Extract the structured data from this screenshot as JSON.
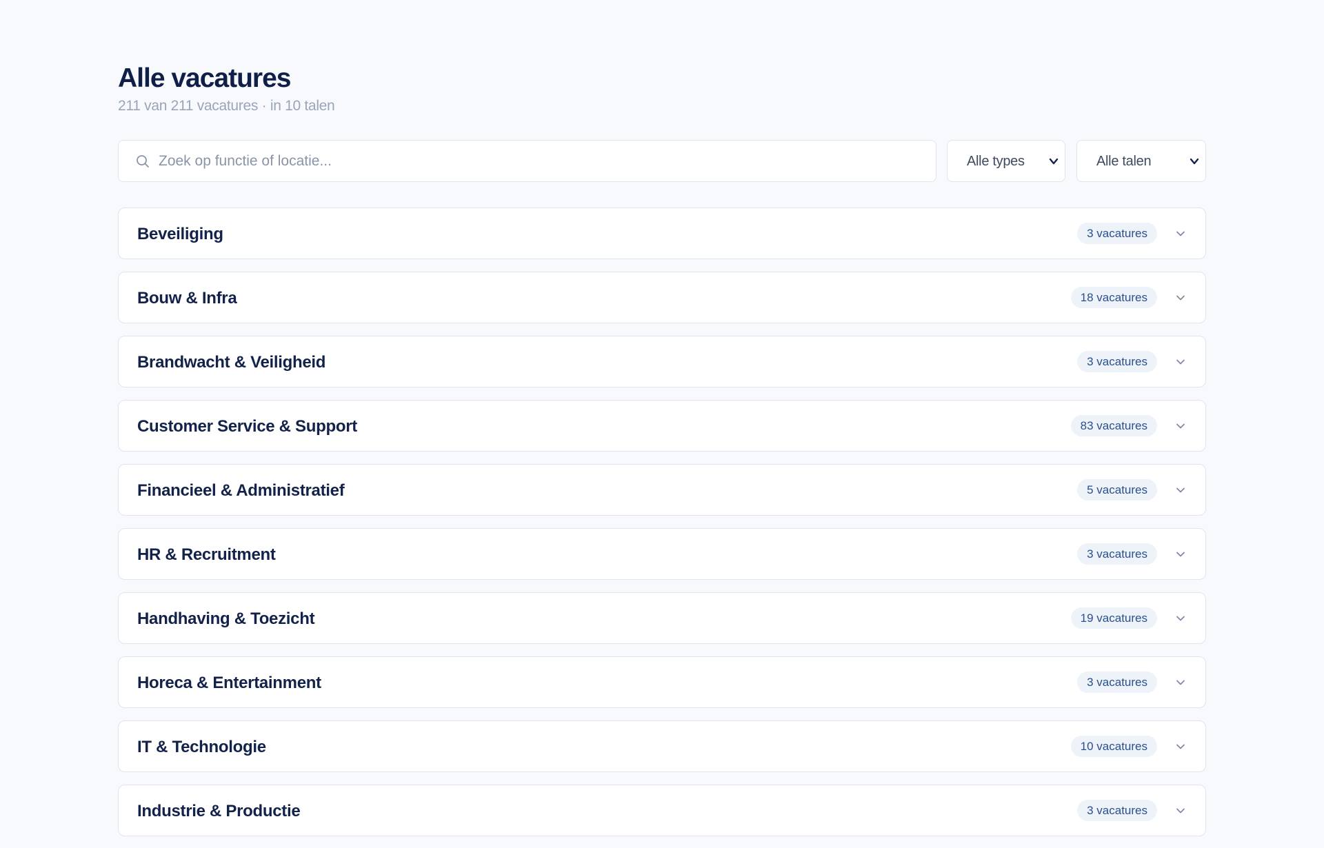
{
  "header": {
    "title": "Alle vacatures",
    "subtitle": "211 van 211 vacatures · in 10 talen"
  },
  "search": {
    "placeholder": "Zoek op functie of locatie...",
    "value": "",
    "icon": "search-icon"
  },
  "filters": {
    "types_label": "Alle types",
    "languages_label": "Alle talen"
  },
  "colors": {
    "background": "#f7f9fc",
    "heading": "#0f1f47",
    "badge_bg": "#eef3fa",
    "badge_text": "#2a4f8c",
    "border": "#dfe5ee"
  },
  "categories": [
    {
      "name": "Beveiliging",
      "count_label": "3 vacatures"
    },
    {
      "name": "Bouw & Infra",
      "count_label": "18 vacatures"
    },
    {
      "name": "Brandwacht & Veiligheid",
      "count_label": "3 vacatures"
    },
    {
      "name": "Customer Service & Support",
      "count_label": "83 vacatures"
    },
    {
      "name": "Financieel & Administratief",
      "count_label": "5 vacatures"
    },
    {
      "name": "HR & Recruitment",
      "count_label": "3 vacatures"
    },
    {
      "name": "Handhaving & Toezicht",
      "count_label": "19 vacatures"
    },
    {
      "name": "Horeca & Entertainment",
      "count_label": "3 vacatures"
    },
    {
      "name": "IT & Technologie",
      "count_label": "10 vacatures"
    },
    {
      "name": "Industrie & Productie",
      "count_label": "3 vacatures"
    }
  ]
}
